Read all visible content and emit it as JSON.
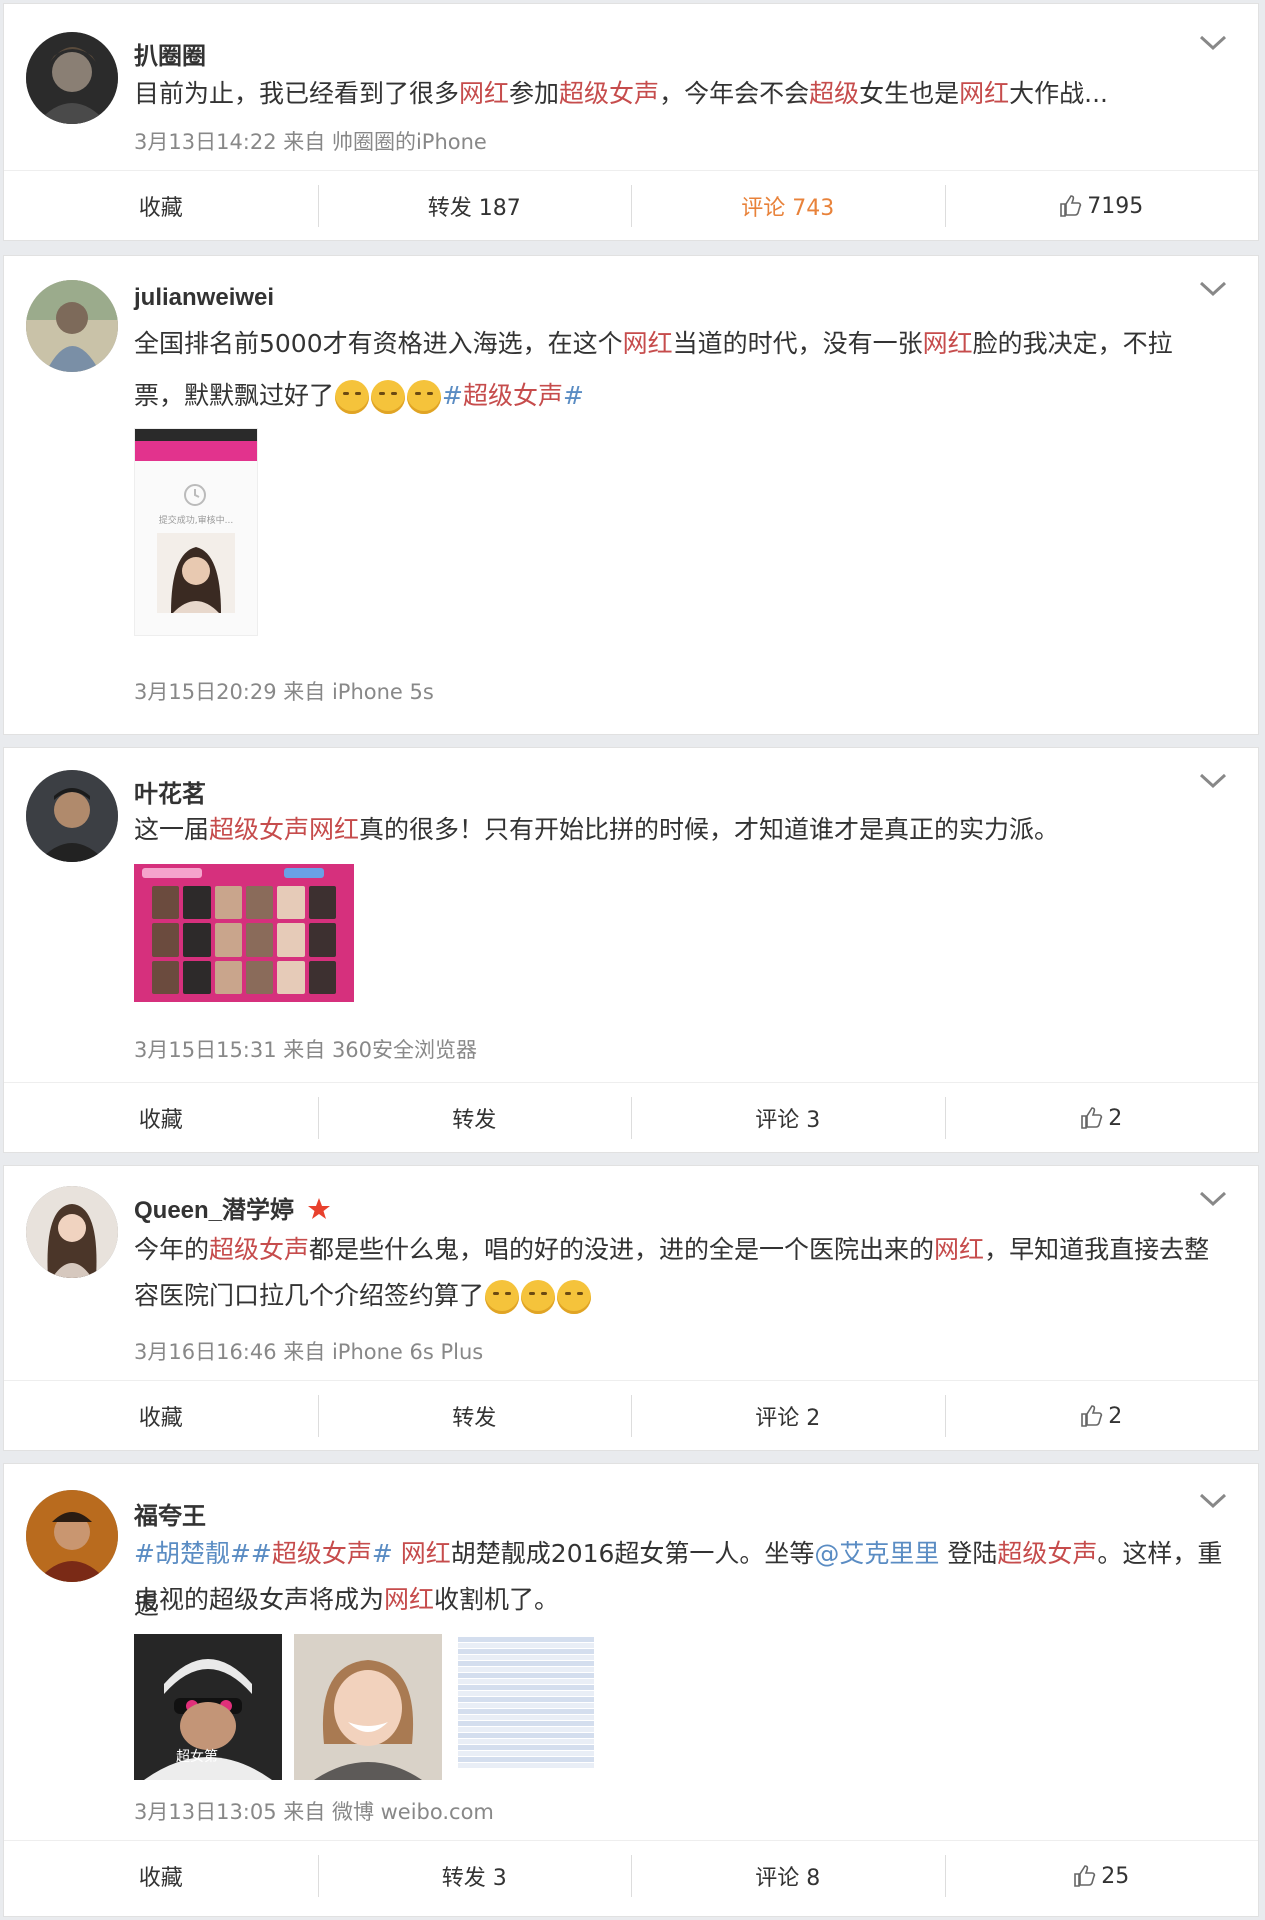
{
  "posts": [
    {
      "username": "扒圈圈",
      "text": [
        {
          "t": "目前为止，我已经看到了很多",
          "c": ""
        },
        {
          "t": "网红",
          "c": "r"
        },
        {
          "t": "参加",
          "c": ""
        },
        {
          "t": "超级女声",
          "c": "r"
        },
        {
          "t": "，今年会不会",
          "c": ""
        },
        {
          "t": "超级",
          "c": "r"
        },
        {
          "t": "女生也是",
          "c": ""
        },
        {
          "t": "网红",
          "c": "r"
        },
        {
          "t": "大作战...",
          "c": ""
        }
      ],
      "meta": "3月13日14:22 来自 帅圈圈的iPhone",
      "actions": {
        "fav": "收藏",
        "repost": "转发 187",
        "comment": "评论 743",
        "like": "7195"
      }
    },
    {
      "username": "julianweiwei",
      "text_line1": [
        {
          "t": "全国排名前5000才有资格进入海选，在这个",
          "c": ""
        },
        {
          "t": "网红",
          "c": "r"
        },
        {
          "t": "当道的时代，没有一张",
          "c": ""
        },
        {
          "t": "网红",
          "c": "r"
        },
        {
          "t": "脸的我决定，不拉",
          "c": ""
        }
      ],
      "text_line2_a": "票，默默飘过好了",
      "text_line2_tag": "#超级女声#",
      "text_line2_tag_parts": [
        "#",
        "超级女声",
        "#"
      ],
      "meta": "3月15日20:29 来自 iPhone 5s",
      "screenshot_text": "提交成功,审核中..."
    },
    {
      "username": "叶花茗",
      "text": [
        {
          "t": "这一届",
          "c": ""
        },
        {
          "t": "超级女声网红",
          "c": "r"
        },
        {
          "t": "真的很多！只有开始比拼的时候，才知道谁才是真正的实力派。",
          "c": ""
        }
      ],
      "meta": "3月15日15:31 来自 360安全浏览器",
      "actions": {
        "fav": "收藏",
        "repost": "转发",
        "comment": "评论 3",
        "like": "2"
      }
    },
    {
      "username": "Queen_潜学婷",
      "text_line1": [
        {
          "t": "今年的",
          "c": ""
        },
        {
          "t": "超级女声",
          "c": "r"
        },
        {
          "t": "都是些什么鬼，唱的好的没进，进的全是一个医院出来的",
          "c": ""
        },
        {
          "t": "网红",
          "c": "r"
        },
        {
          "t": "，早知道我直接去整",
          "c": ""
        }
      ],
      "text_line2": "容医院门口拉几个介绍签约算了",
      "meta": "3月16日16:46 来自 iPhone 6s Plus",
      "actions": {
        "fav": "收藏",
        "repost": "转发",
        "comment": "评论 2",
        "like": "2"
      }
    },
    {
      "username": "福夸王",
      "text_line1": [
        {
          "t": "#胡楚靓#",
          "c": "b"
        },
        {
          "t": "#",
          "c": "b"
        },
        {
          "t": "超级女声",
          "c": "r"
        },
        {
          "t": "# ",
          "c": "b"
        },
        {
          "t": "网红",
          "c": "r"
        },
        {
          "t": "胡楚靓成2016超女第一人。坐等",
          "c": ""
        },
        {
          "t": "@艾克里里",
          "c": "b"
        },
        {
          "t": " 登陆",
          "c": ""
        },
        {
          "t": "超级女声",
          "c": "r"
        },
        {
          "t": "。这样，重返",
          "c": ""
        }
      ],
      "text_line2": [
        {
          "t": "电视的超级女声将成为",
          "c": ""
        },
        {
          "t": "网红",
          "c": "r"
        },
        {
          "t": "收割机了。",
          "c": ""
        }
      ],
      "meta": "3月13日13:05 来自 微博 weibo.com",
      "img_caption": "超女第",
      "actions": {
        "fav": "收藏",
        "repost": "转发 3",
        "comment": "评论 8",
        "like": "25"
      }
    }
  ],
  "colors": {
    "highlight": "#c64c4c",
    "link": "#5a8cc3",
    "active": "#e8823a",
    "meta": "#888888"
  }
}
